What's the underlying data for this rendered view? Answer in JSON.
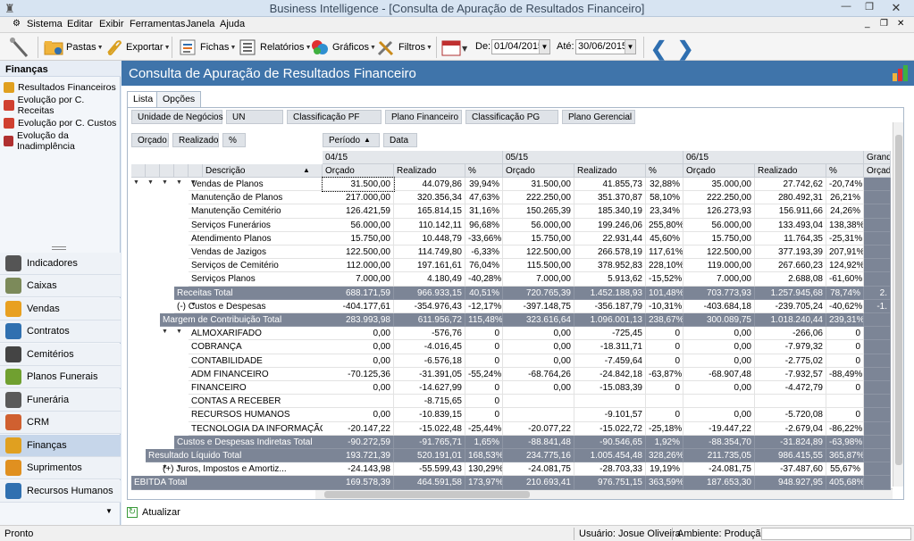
{
  "window": {
    "title": "Business Intelligence - [Consulta de Apuração de Resultados Financeiro]"
  },
  "menu": [
    "Sistema",
    "Editar",
    "Exibir",
    "Ferramentas",
    "Janela",
    "Ajuda"
  ],
  "toolbar": {
    "pastas": "Pastas",
    "exportar": "Exportar",
    "fichas": "Fichas",
    "relatorios": "Relatórios",
    "graficos": "Gráficos",
    "filtros": "Filtros",
    "de_label": "De:",
    "de_value": "01/04/2015",
    "ate_label": "Até:",
    "ate_value": "30/06/2015"
  },
  "sidebar": {
    "header": "Finanças",
    "reports": [
      "Resultados Financeiros",
      "Evolução por C. Receitas",
      "Evolução por C. Custos",
      "Evolução da Inadimplência"
    ],
    "modules": [
      "Indicadores",
      "Caixas",
      "Vendas",
      "Contratos",
      "Cemitérios",
      "Planos Funerais",
      "Funerária",
      "CRM",
      "Finanças",
      "Suprimentos",
      "Recursos Humanos"
    ],
    "active_module": "Finanças"
  },
  "content": {
    "title": "Consulta de Apuração de Resultados Financeiro",
    "tabs": [
      "Lista",
      "Opções"
    ],
    "active_tab": "Lista"
  },
  "pivot": {
    "filter_fields": [
      "Unidade de Negócios",
      "UN",
      "Classificação PF",
      "Plano Financeiro",
      "Classificação PG",
      "Plano Gerencial"
    ],
    "data_fields": [
      "Orçado",
      "Realizado",
      "%"
    ],
    "column_fields": [
      "Período",
      "Data"
    ],
    "row_header": "Descrição",
    "periods": [
      "04/15",
      "05/15",
      "06/15",
      "Grand T"
    ],
    "measures": [
      "Orçado",
      "Realizado",
      "%"
    ],
    "rows": [
      {
        "label": "Vendas de Planos",
        "indent": 4,
        "values": [
          "31.500,00",
          "44.079,86",
          "39,94%",
          "31.500,00",
          "41.855,73",
          "32,88%",
          "35.000,00",
          "27.742,62",
          "-20,74%"
        ]
      },
      {
        "label": "Manutenção de Planos",
        "indent": 4,
        "values": [
          "217.000,00",
          "320.356,34",
          "47,63%",
          "222.250,00",
          "351.370,87",
          "58,10%",
          "222.250,00",
          "280.492,31",
          "26,21%"
        ]
      },
      {
        "label": "Manutenção Cemitério",
        "indent": 4,
        "values": [
          "126.421,59",
          "165.814,15",
          "31,16%",
          "150.265,39",
          "185.340,19",
          "23,34%",
          "126.273,93",
          "156.911,66",
          "24,26%"
        ]
      },
      {
        "label": "Serviços Funerários",
        "indent": 4,
        "values": [
          "56.000,00",
          "110.142,11",
          "96,68%",
          "56.000,00",
          "199.246,06",
          "255,80%",
          "56.000,00",
          "133.493,04",
          "138,38%"
        ]
      },
      {
        "label": "Atendimento Planos",
        "indent": 4,
        "values": [
          "15.750,00",
          "10.448,79",
          "-33,66%",
          "15.750,00",
          "22.931,44",
          "45,60%",
          "15.750,00",
          "11.764,35",
          "-25,31%"
        ]
      },
      {
        "label": "Vendas de Jazigos",
        "indent": 4,
        "values": [
          "122.500,00",
          "114.749,80",
          "-6,33%",
          "122.500,00",
          "266.578,19",
          "117,61%",
          "122.500,00",
          "377.193,39",
          "207,91%"
        ]
      },
      {
        "label": "Serviços de Cemitério",
        "indent": 4,
        "values": [
          "112.000,00",
          "197.161,61",
          "76,04%",
          "115.500,00",
          "378.952,83",
          "228,10%",
          "119.000,00",
          "267.660,23",
          "124,92%"
        ]
      },
      {
        "label": "Serviços Planos",
        "indent": 4,
        "values": [
          "7.000,00",
          "4.180,49",
          "-40,28%",
          "7.000,00",
          "5.913,62",
          "-15,52%",
          "7.000,00",
          "2.688,08",
          "-61,60%"
        ]
      },
      {
        "label": "Receitas Total",
        "indent": 3,
        "total": true,
        "values": [
          "688.171,59",
          "966.933,15",
          "40,51%",
          "720.765,39",
          "1.452.188,93",
          "101,48%",
          "703.773,93",
          "1.257.945,68",
          "78,74%"
        ],
        "extra": "2."
      },
      {
        "label": "(-) Custos e Despesas",
        "indent": 3,
        "collapsed": true,
        "values": [
          "-404.177,61",
          "-354.976,43",
          "-12,17%",
          "-397.148,75",
          "-356.187,79",
          "-10,31%",
          "-403.684,18",
          "-239.705,24",
          "-40,62%"
        ],
        "extra": "-1."
      },
      {
        "label": "Margem de Contribuição Total",
        "indent": 2,
        "total": true,
        "values": [
          "283.993,98",
          "611.956,72",
          "115,48%",
          "323.616,64",
          "1.096.001,13",
          "238,67%",
          "300.089,75",
          "1.018.240,44",
          "239,31%"
        ],
        "extra": ""
      },
      {
        "label": "ALMOXARIFADO",
        "indent": 4,
        "values": [
          "0,00",
          "-576,76",
          "0",
          "0,00",
          "-725,45",
          "0",
          "0,00",
          "-266,06",
          "0"
        ]
      },
      {
        "label": "COBRANÇA",
        "indent": 4,
        "values": [
          "0,00",
          "-4.016,45",
          "0",
          "0,00",
          "-18.311,71",
          "0",
          "0,00",
          "-7.979,32",
          "0"
        ]
      },
      {
        "label": "CONTABILIDADE",
        "indent": 4,
        "values": [
          "0,00",
          "-6.576,18",
          "0",
          "0,00",
          "-7.459,64",
          "0",
          "0,00",
          "-2.775,02",
          "0"
        ]
      },
      {
        "label": "ADM FINANCEIRO",
        "indent": 4,
        "values": [
          "-70.125,36",
          "-31.391,05",
          "-55,24%",
          "-68.764,26",
          "-24.842,18",
          "-63,87%",
          "-68.907,48",
          "-7.932,57",
          "-88,49%"
        ]
      },
      {
        "label": "FINANCEIRO",
        "indent": 4,
        "values": [
          "0,00",
          "-14.627,99",
          "0",
          "0,00",
          "-15.083,39",
          "0",
          "0,00",
          "-4.472,79",
          "0"
        ]
      },
      {
        "label": "CONTAS A RECEBER",
        "indent": 4,
        "values": [
          "",
          "-8.715,65",
          "0",
          "",
          "",
          "",
          "",
          "",
          ""
        ]
      },
      {
        "label": "RECURSOS HUMANOS",
        "indent": 4,
        "values": [
          "0,00",
          "-10.839,15",
          "0",
          "",
          "-9.101,57",
          "0",
          "0,00",
          "-5.720,08",
          "0"
        ]
      },
      {
        "label": "TECNOLOGIA DA INFORMAÇÃO",
        "indent": 4,
        "values": [
          "-20.147,22",
          "-15.022,48",
          "-25,44%",
          "-20.077,22",
          "-15.022,72",
          "-25,18%",
          "-19.447,22",
          "-2.679,04",
          "-86,22%"
        ]
      },
      {
        "label": "Custos e Despesas Indiretas Total",
        "indent": 3,
        "total": true,
        "values": [
          "-90.272,59",
          "-91.765,71",
          "1,65%",
          "-88.841,48",
          "-90.546,65",
          "1,92%",
          "-88.354,70",
          "-31.824,89",
          "-63,98%"
        ]
      },
      {
        "label": "Resultado Líquido Total",
        "indent": 1,
        "total": true,
        "values": [
          "193.721,39",
          "520.191,01",
          "168,53%",
          "234.775,16",
          "1.005.454,48",
          "328,26%",
          "211.735,05",
          "986.415,55",
          "365,87%"
        ]
      },
      {
        "label": "(+) Juros, Impostos e Amortiz...",
        "indent": 2,
        "collapsed": true,
        "values": [
          "-24.143,98",
          "-55.599,43",
          "130,29%",
          "-24.081,75",
          "-28.703,33",
          "19,19%",
          "-24.081,75",
          "-37.487,60",
          "55,67%"
        ]
      },
      {
        "label": "EBITDA Total",
        "indent": 0,
        "total": true,
        "values": [
          "169.578,39",
          "464.591,58",
          "173,97%",
          "210.693,41",
          "976.751,15",
          "363,59%",
          "187.653,30",
          "948.927,95",
          "405,68%"
        ]
      }
    ]
  },
  "refresh_label": "Atualizar",
  "status": {
    "left": "Pronto",
    "user": "Usuário: Josue Oliveira",
    "env": "Ambiente: Produção"
  }
}
